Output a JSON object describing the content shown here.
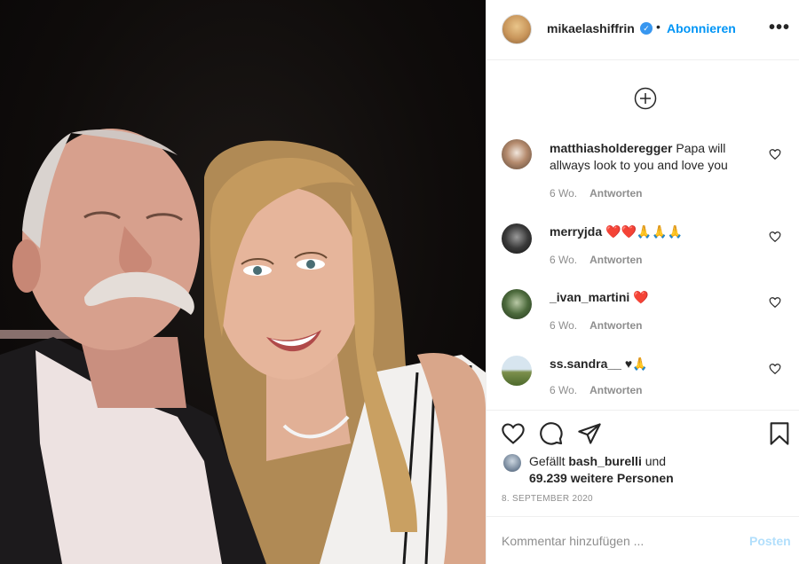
{
  "header": {
    "username": "mikaelashiffrin",
    "verified_icon": "verified-badge-icon",
    "separator": "•",
    "follow_label": "Abonnieren",
    "more_label": "•••"
  },
  "load_more_icon": "plus-circle-icon",
  "comments": [
    {
      "user": "matthiasholderegger",
      "text": "Papa will allways look to you and love you",
      "age": "6 Wo.",
      "reply": "Antworten"
    },
    {
      "user": "merryjda",
      "text": "❤️❤️🙏🙏🙏",
      "age": "6 Wo.",
      "reply": "Antworten"
    },
    {
      "user": "_ivan_martini",
      "text": "❤️",
      "age": "6 Wo.",
      "reply": "Antworten"
    },
    {
      "user": "ss.sandra__",
      "text": "♥🙏",
      "age": "6 Wo.",
      "reply": "Antworten"
    }
  ],
  "actions": {
    "like_icon": "heart-icon",
    "comment_icon": "comment-icon",
    "share_icon": "share-icon",
    "save_icon": "bookmark-icon"
  },
  "likes": {
    "prefix": "Gefällt",
    "user": "bash_burelli",
    "suffix": "und",
    "count": "69.239",
    "count_suffix": "weitere Personen"
  },
  "date": "8. SEPTEMBER 2020",
  "comment_box": {
    "placeholder": "Kommentar hinzufügen ...",
    "post_label": "Posten"
  },
  "colors": {
    "accent": "#0095f6",
    "post_disabled": "#b2dffc",
    "verified": "#3897f0",
    "heart_emoji": "#e0245e"
  }
}
